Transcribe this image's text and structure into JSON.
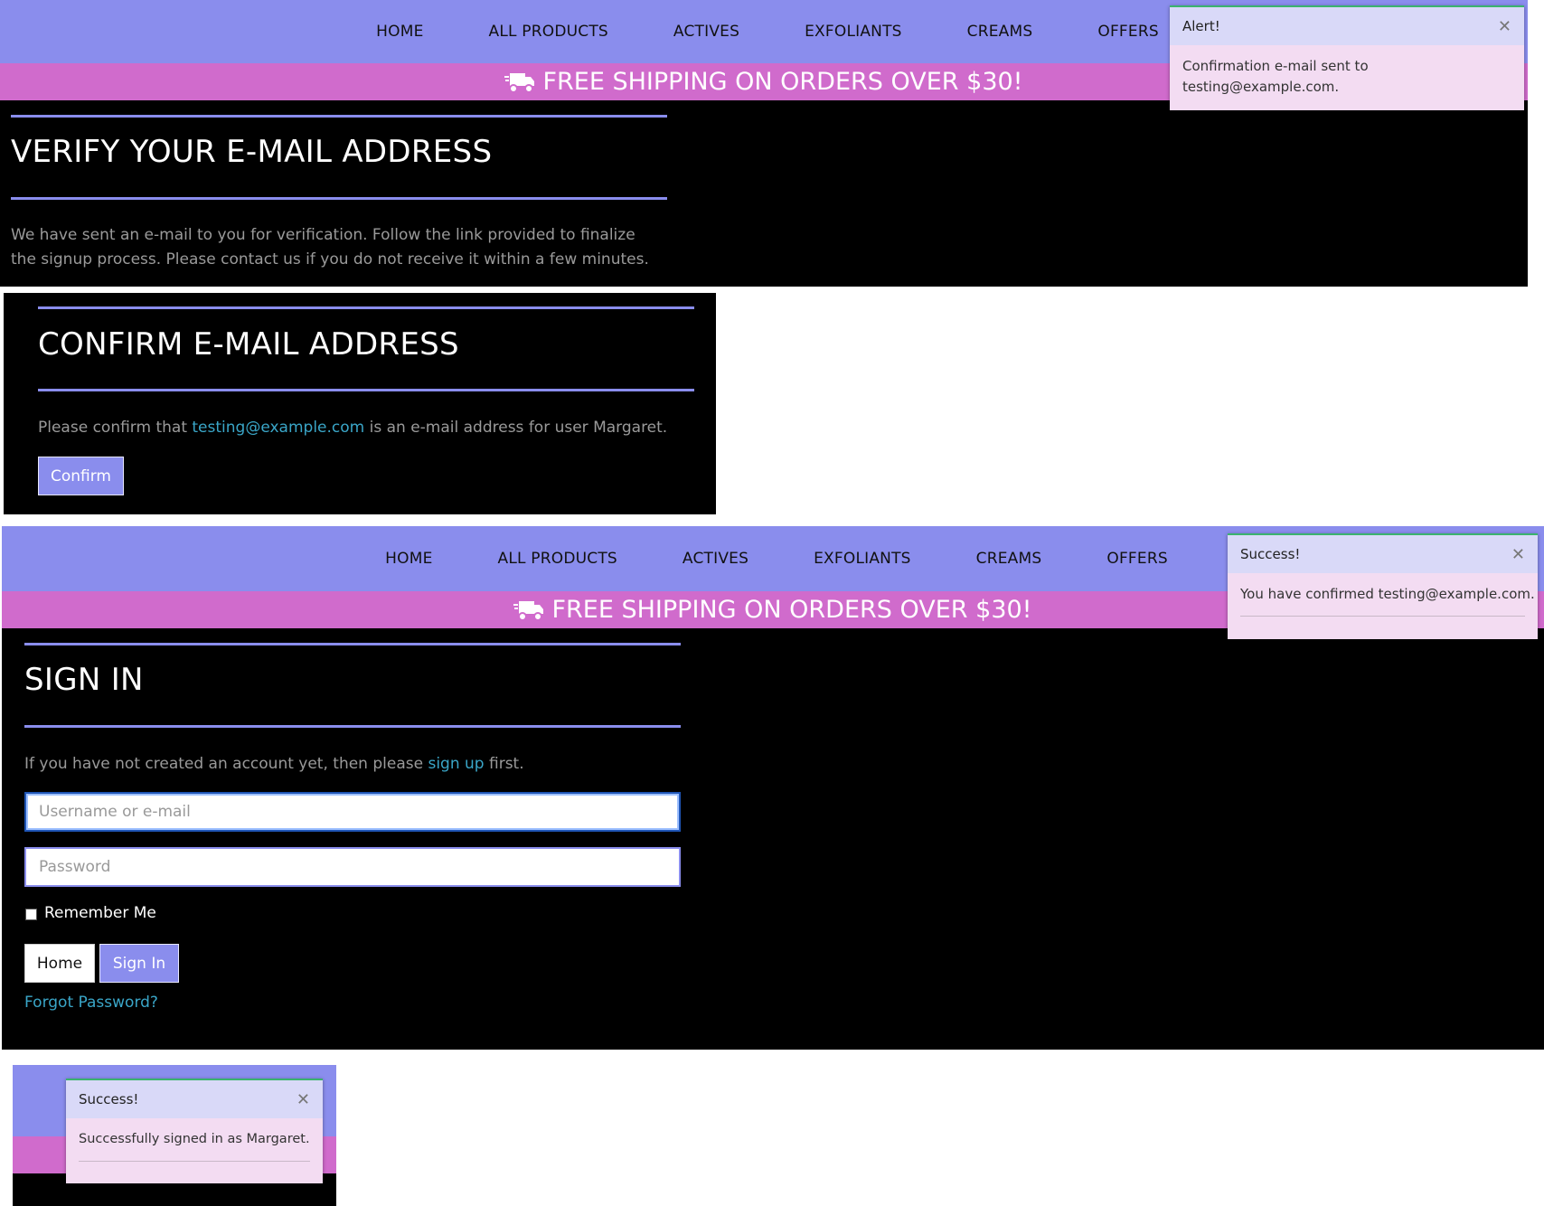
{
  "nav": {
    "items": [
      "HOME",
      "ALL PRODUCTS",
      "ACTIVES",
      "EXFOLIANTS",
      "CREAMS",
      "OFFERS"
    ]
  },
  "promo": {
    "text": "FREE SHIPPING ON ORDERS OVER $30!"
  },
  "colors": {
    "nav_bg": "#8a8ded",
    "promo_bg": "#d06bcc",
    "accent": "#8a8ded",
    "link": "#3aa6c8"
  },
  "verify": {
    "title": "VERIFY YOUR E-MAIL ADDRESS",
    "body": "We have sent an e-mail to you for verification. Follow the link provided to finalize the signup process. Please contact us if you do not receive it within a few minutes."
  },
  "alert_toast": {
    "title": "Alert!",
    "body": "Confirmation e-mail sent to testing@example.com."
  },
  "confirm": {
    "title": "CONFIRM E-MAIL ADDRESS",
    "prefix": "Please confirm that",
    "email": "testing@example.com",
    "suffix": "is an e-mail address for user Margaret.",
    "button": "Confirm"
  },
  "success_toast": {
    "title": "Success!",
    "body": "You have confirmed testing@example.com."
  },
  "signin": {
    "title": "SIGN IN",
    "prefix": "If you have not created an account yet, then please",
    "signup_link": "sign up",
    "suffix": "first.",
    "username_placeholder": "Username or e-mail",
    "password_placeholder": "Password",
    "remember": "Remember Me",
    "home_button": "Home",
    "signin_button": "Sign In",
    "forgot": "Forgot Password?"
  },
  "signed_toast": {
    "title": "Success!",
    "body": "Successfully signed in as Margaret."
  },
  "icons": {
    "truck": "truck-icon",
    "close": "close-icon"
  }
}
